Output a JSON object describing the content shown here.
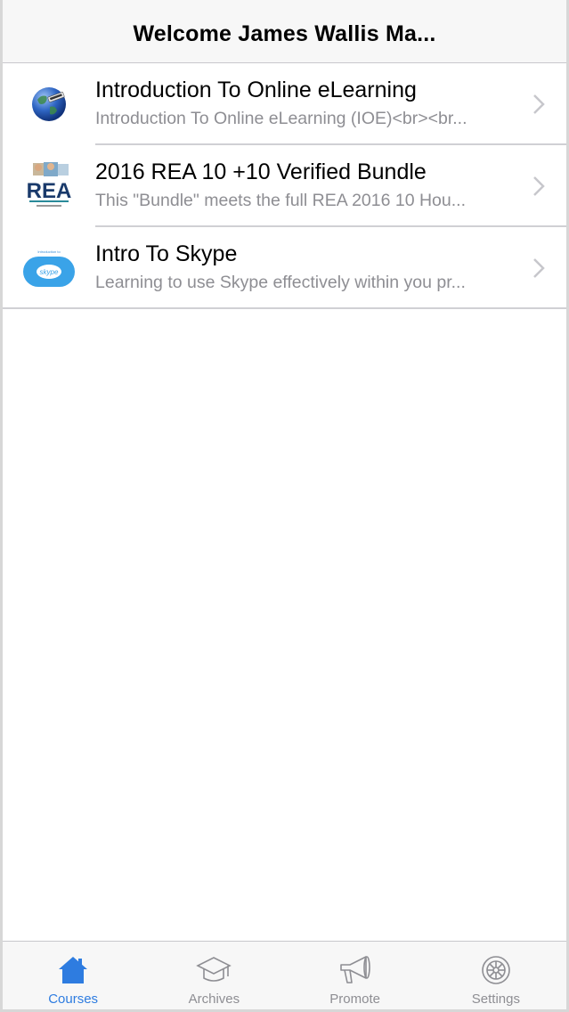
{
  "navbar": {
    "title": "Welcome James Wallis Ma..."
  },
  "courses": [
    {
      "title": "Introduction To Online eLearning",
      "subtitle": "Introduction To Online eLearning (IOE)<br><br...",
      "thumb_icon": "globe-icon"
    },
    {
      "title": "2016 REA 10 +10 Verified Bundle",
      "subtitle": "This \"Bundle\" meets the full REA 2016 10 Hou...",
      "thumb_icon": "rea-logo-icon",
      "thumb_text": "REA"
    },
    {
      "title": "Intro To Skype",
      "subtitle": "Learning to use Skype effectively within you pr...",
      "thumb_icon": "skype-icon",
      "thumb_text": "skype",
      "thumb_caption": "Introduction to"
    }
  ],
  "tabs": [
    {
      "label": "Courses",
      "icon": "house-icon",
      "active": true
    },
    {
      "label": "Archives",
      "icon": "graduation-cap-icon",
      "active": false
    },
    {
      "label": "Promote",
      "icon": "megaphone-icon",
      "active": false
    },
    {
      "label": "Settings",
      "icon": "gear-icon",
      "active": false
    }
  ],
  "colors": {
    "accent": "#2e7ce0",
    "inactive": "#8e8e93",
    "bar_bg": "#f7f7f7"
  }
}
